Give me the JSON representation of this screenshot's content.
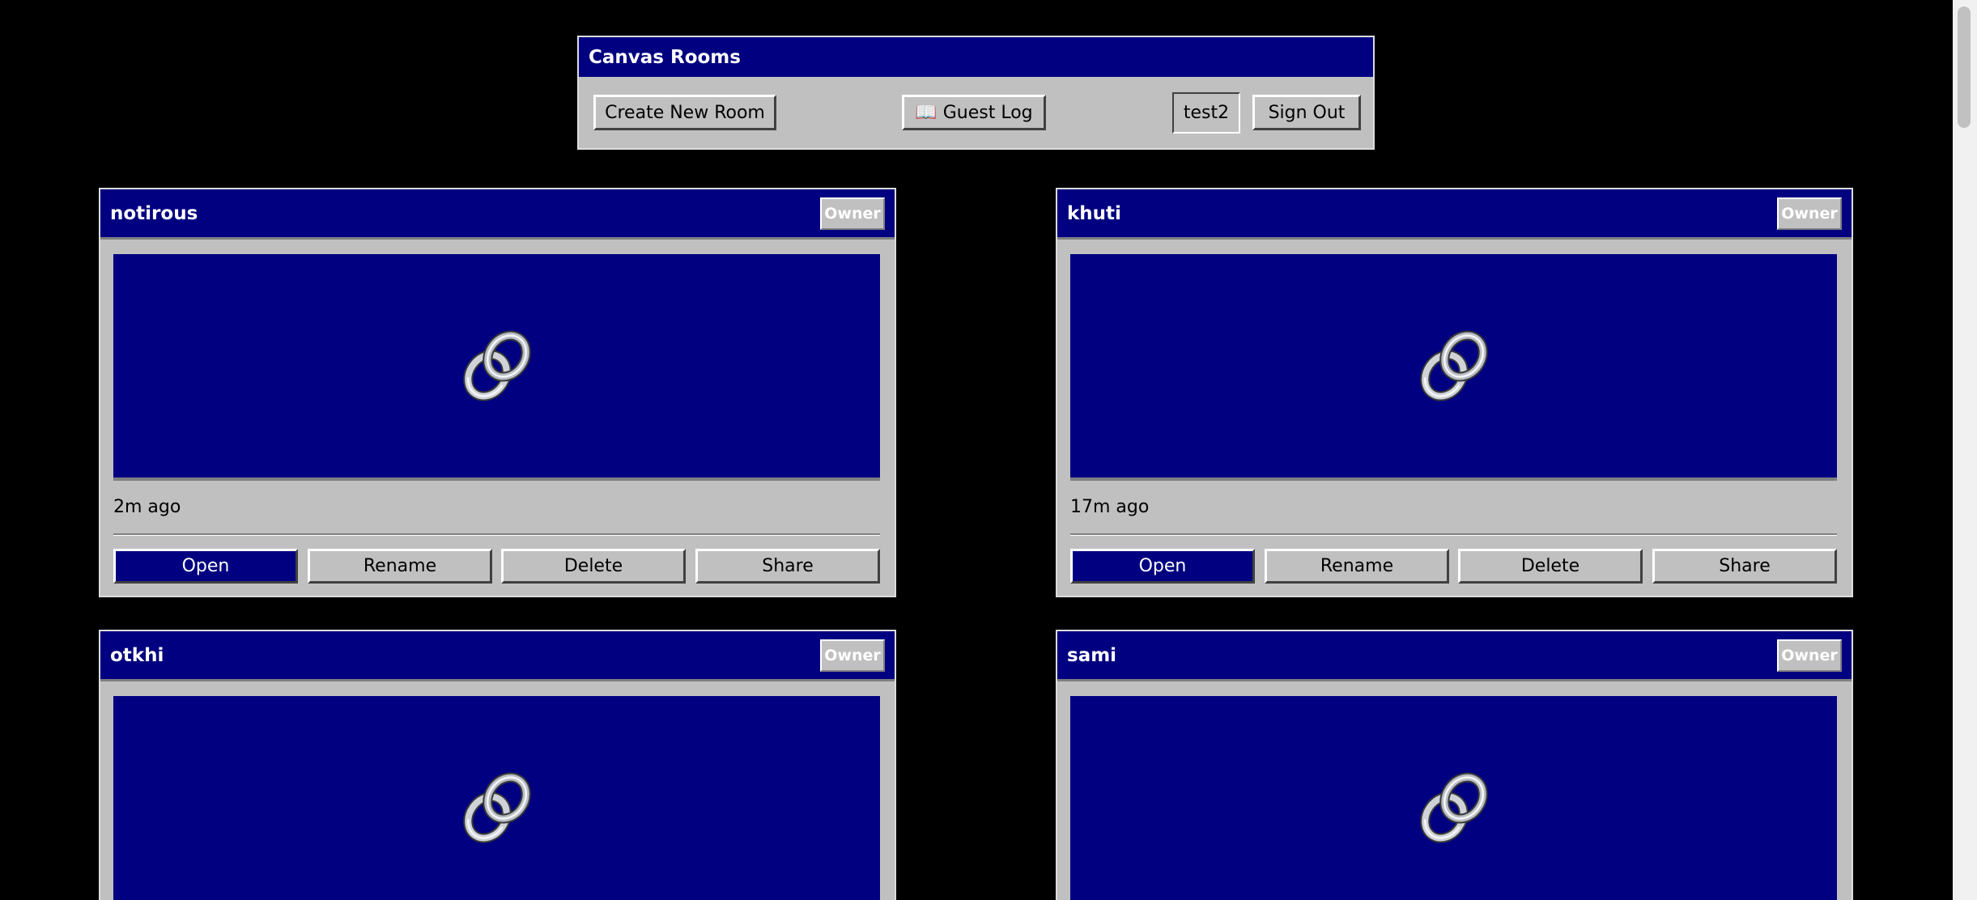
{
  "header": {
    "title": "Canvas Rooms",
    "create_room_label": "Create New Room",
    "guest_log_icon": "book-icon",
    "guest_log_label": "📖 Guest Log",
    "username": "test2",
    "sign_out_label": "Sign Out"
  },
  "colors": {
    "background": "#000000",
    "titlebar": "#000080",
    "window": "#c0c0c0",
    "preview": "#000080"
  },
  "rooms": [
    {
      "name": "notirous",
      "role": "Owner",
      "icon": "link-icon",
      "time": "2m ago",
      "open_label": "Open",
      "rename_label": "Rename",
      "delete_label": "Delete",
      "share_label": "Share"
    },
    {
      "name": "khuti",
      "role": "Owner",
      "icon": "link-icon",
      "time": "17m ago",
      "open_label": "Open",
      "rename_label": "Rename",
      "delete_label": "Delete",
      "share_label": "Share"
    },
    {
      "name": "otkhi",
      "role": "Owner",
      "icon": "link-icon"
    },
    {
      "name": "sami",
      "role": "Owner",
      "icon": "link-icon"
    }
  ]
}
